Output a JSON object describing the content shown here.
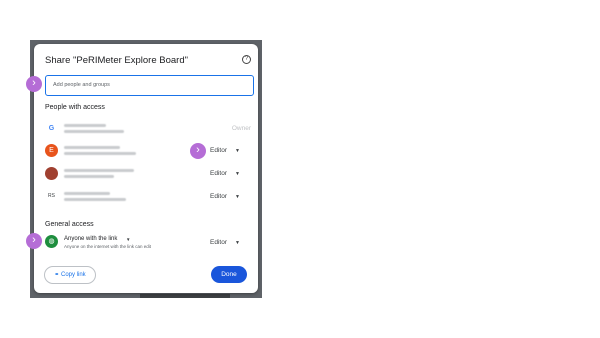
{
  "dialog": {
    "title": "Share \"PeRIMeter Explore Board\"",
    "help_icon": "?",
    "add_placeholder": "Add people and groups",
    "people_heading": "People with access",
    "people": [
      {
        "avatar": "G",
        "avatar_color": "#4285f4",
        "role": "Owner"
      },
      {
        "avatar": "E",
        "avatar_color": "#e8541c",
        "role": "Editor"
      },
      {
        "avatar": "",
        "avatar_color": "#a04030",
        "role": "Editor"
      },
      {
        "avatar": "RS",
        "avatar_color": "#ffffff",
        "role": "Editor"
      }
    ],
    "general_heading": "General access",
    "general_scope": "Anyone with the link",
    "general_desc": "Anyone on the internet with the link can edit",
    "general_role": "Editor",
    "copy_link": "Copy link",
    "done": "Done"
  },
  "colors": {
    "accent": "#1a73e8",
    "marker": "#b56dd6",
    "done": "#1a56db"
  },
  "icons": {
    "marker": "chevron-right-icon",
    "caret": "caret-down-icon",
    "link": "link-icon"
  }
}
